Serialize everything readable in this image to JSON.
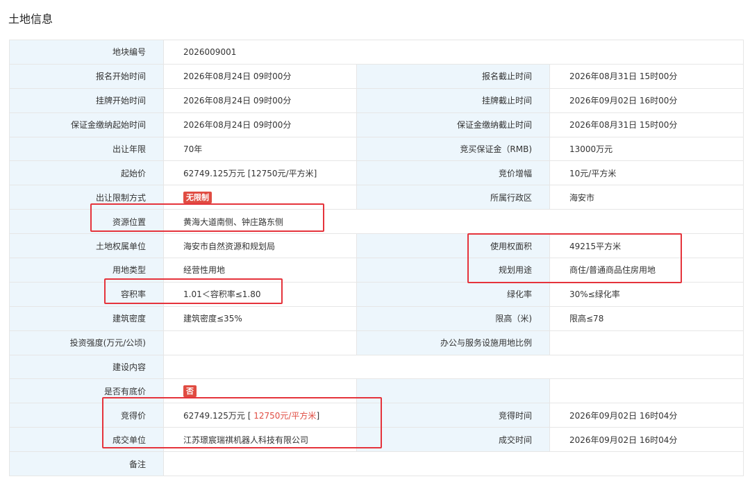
{
  "page_title": "土地信息",
  "colors": {
    "label_bg": "#edf6fc",
    "badge_bg": "#e04c42",
    "highlight_border": "#e5333b",
    "accent_text": "#e04c42"
  },
  "fields": {
    "parcel_no": {
      "label": "地块编号",
      "value": "2026009001"
    },
    "reg_start": {
      "label": "报名开始时间",
      "value": "2026年08月24日 09时00分"
    },
    "reg_end": {
      "label": "报名截止时间",
      "value": "2026年08月31日 15时00分"
    },
    "list_start": {
      "label": "挂牌开始时间",
      "value": "2026年08月24日 09时00分"
    },
    "list_end": {
      "label": "挂牌截止时间",
      "value": "2026年09月02日 16时00分"
    },
    "deposit_start": {
      "label": "保证金缴纳起始时间",
      "value": "2026年08月24日 09时00分"
    },
    "deposit_end": {
      "label": "保证金缴纳截止时间",
      "value": "2026年08月31日 15时00分"
    },
    "term": {
      "label": "出让年限",
      "value": "70年"
    },
    "bid_deposit": {
      "label": "竞买保证金（RMB)",
      "value": "13000万元"
    },
    "start_price": {
      "label": "起始价",
      "value": "62749.125万元 [12750元/平方米]"
    },
    "increment": {
      "label": "竞价增幅",
      "value": "10元/平方米"
    },
    "restriction": {
      "label": "出让限制方式",
      "badge": "无限制"
    },
    "district": {
      "label": "所属行政区",
      "value": "海安市"
    },
    "location": {
      "label": "资源位置",
      "value": "黄海大道南侧、钟庄路东侧"
    },
    "owner": {
      "label": "土地权属单位",
      "value": "海安市自然资源和规划局"
    },
    "area": {
      "label": "使用权面积",
      "value": "49215平方米"
    },
    "land_type": {
      "label": "用地类型",
      "value": "经营性用地"
    },
    "planned_use": {
      "label": "规划用途",
      "value": "商住/普通商品住房用地"
    },
    "far": {
      "label": "容积率",
      "value": "1.01＜容积率≤1.80"
    },
    "green": {
      "label": "绿化率",
      "value": "30%≤绿化率"
    },
    "density": {
      "label": "建筑密度",
      "value": "建筑密度≤35%"
    },
    "height": {
      "label": "限高（米)",
      "value": "限高≤78"
    },
    "investment": {
      "label": "投资强度(万元/公顷)",
      "value": ""
    },
    "office_ratio": {
      "label": "办公与服务设施用地比例",
      "value": ""
    },
    "construction": {
      "label": "建设内容",
      "value": ""
    },
    "reserve": {
      "label": "是否有底价",
      "badge": "否"
    },
    "winning_price": {
      "label": "竞得价",
      "value_prefix": "62749.125万元 [",
      "value_unit": " 12750元/平方米",
      "value_suffix": "]"
    },
    "winning_time": {
      "label": "竞得时间",
      "value": "2026年09月02日 16时04分"
    },
    "winner": {
      "label": "成交单位",
      "value": "江苏璟宸瑞祺机器人科技有限公司"
    },
    "deal_time": {
      "label": "成交时间",
      "value": "2026年09月02日 16时04分"
    },
    "remarks": {
      "label": "备注",
      "value": ""
    }
  }
}
